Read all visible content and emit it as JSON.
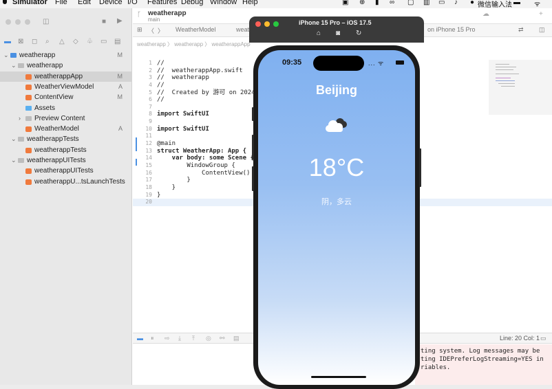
{
  "menubar": {
    "items": [
      "Simulator",
      "File",
      "Edit",
      "Device",
      "I/O",
      "Features",
      "Debug",
      "Window",
      "Help"
    ],
    "input_method": "微信输入法"
  },
  "xcode": {
    "scheme": "weatherapp",
    "scheme_sub": "main",
    "tabs": [
      "WeatherModel",
      "weatherapp",
      "on iPhone 15 Pro"
    ],
    "breadcrumb": "weatherapp 〉 weatherapp 〉 weatherappApp",
    "navigator": [
      {
        "label": "weatherapp",
        "badge": "M",
        "icon": "project-icon",
        "indent": 0,
        "disclosure": "v"
      },
      {
        "label": "weatherapp",
        "badge": "",
        "icon": "folder-icon",
        "indent": 1,
        "disclosure": "v"
      },
      {
        "label": "weatherappApp",
        "badge": "M",
        "icon": "swift-file-icon",
        "indent": 2,
        "disclosure": "",
        "selected": true
      },
      {
        "label": "WeatherViewModel",
        "badge": "A",
        "icon": "swift-file-icon",
        "indent": 2,
        "disclosure": ""
      },
      {
        "label": "ContentView",
        "badge": "M",
        "icon": "swift-file-icon",
        "indent": 2,
        "disclosure": ""
      },
      {
        "label": "Assets",
        "badge": "",
        "icon": "assets-icon",
        "indent": 2,
        "disclosure": ""
      },
      {
        "label": "Preview Content",
        "badge": "",
        "icon": "folder-icon",
        "indent": 2,
        "disclosure": ">"
      },
      {
        "label": "WeatherModel",
        "badge": "A",
        "icon": "swift-file-icon",
        "indent": 2,
        "disclosure": ""
      },
      {
        "label": "weatherappTests",
        "badge": "",
        "icon": "folder-icon",
        "indent": 1,
        "disclosure": "v"
      },
      {
        "label": "weatherappTests",
        "badge": "",
        "icon": "swift-file-icon",
        "indent": 2,
        "disclosure": ""
      },
      {
        "label": "weatherappUITests",
        "badge": "",
        "icon": "folder-icon",
        "indent": 1,
        "disclosure": "v"
      },
      {
        "label": "weatherappUITests",
        "badge": "",
        "icon": "swift-file-icon",
        "indent": 2,
        "disclosure": ""
      },
      {
        "label": "weatherappU...tsLaunchTests",
        "badge": "",
        "icon": "swift-file-icon",
        "indent": 2,
        "disclosure": ""
      }
    ],
    "code": [
      "//",
      "//  weatherappApp.swift",
      "//  weatherapp",
      "//",
      "//  Created by 游可 on 2024/",
      "//",
      "",
      "import SwiftUI",
      "",
      "import SwiftUI",
      "",
      "@main",
      "struct WeatherApp: App {",
      "    var body: some Scene {",
      "        WindowGroup {",
      "            ContentView()",
      "        }",
      "    }",
      "}",
      ""
    ],
    "cursor_position": "Line: 20  Col: 1",
    "console_lines": [
      "ting system. Log messages may be",
      "ting IDEPreferLogStreaming=YES in",
      "riables."
    ]
  },
  "simulator": {
    "title": "iPhone 15 Pro – iOS 17.5",
    "colors": {
      "close": "#ff5f57",
      "min": "#febc2e",
      "max": "#28c840"
    }
  },
  "phone": {
    "time": "09:35",
    "status": "... ᯤ",
    "city": "Beijing",
    "temperature": "18°C",
    "condition": "阴，多云",
    "weather_icon": "cloud-icon"
  }
}
